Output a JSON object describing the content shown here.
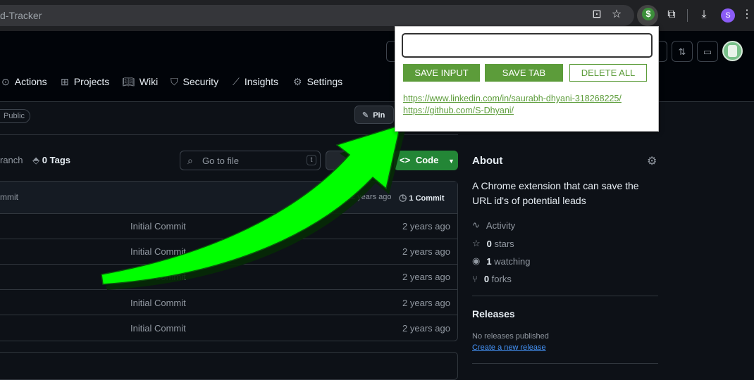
{
  "browser": {
    "url_fragment": "d-Tracker",
    "profile_initial": "S",
    "extension_symbol": "$"
  },
  "repo_nav": {
    "items": [
      {
        "label": "Actions",
        "icon": "play-circle-icon"
      },
      {
        "label": "Projects",
        "icon": "table-icon"
      },
      {
        "label": "Wiki",
        "icon": "book-icon"
      },
      {
        "label": "Security",
        "icon": "shield-icon"
      },
      {
        "label": "Insights",
        "icon": "graph-icon"
      },
      {
        "label": "Settings",
        "icon": "gear-icon"
      }
    ]
  },
  "repo": {
    "visibility": "Public",
    "pin_label": "Pin",
    "branch_label": "ranch",
    "tags_count": "0",
    "tags_label": "Tags",
    "go_to_file_placeholder": "Go to file",
    "go_to_file_shortcut": "t",
    "code_button": "Code"
  },
  "files": {
    "head_commit": "mmit",
    "head_time": "2 years ago",
    "commit_count": "1 Commit",
    "rows": [
      {
        "message": "Initial Commit",
        "time": "2 years ago"
      },
      {
        "message": "Initial Commit",
        "time": "2 years ago"
      },
      {
        "message": "Initial Commit",
        "time": "2 years ago"
      },
      {
        "message": "Initial Commit",
        "time": "2 years ago"
      },
      {
        "message": "Initial Commit",
        "time": "2 years ago"
      }
    ]
  },
  "about": {
    "title": "About",
    "description": "A Chrome extension that can save the URL id's of potential leads",
    "activity": "Activity",
    "stars_count": "0",
    "stars_label": "stars",
    "watching_count": "1",
    "watching_label": "watching",
    "forks_count": "0",
    "forks_label": "forks"
  },
  "releases": {
    "title": "Releases",
    "empty_text": "No releases published",
    "create_link": "Create a new release"
  },
  "popup": {
    "input_value": "",
    "save_input": "SAVE INPUT",
    "save_tab": "SAVE TAB",
    "delete_all": "DELETE ALL",
    "links": [
      "https://www.linkedin.com/in/saurabh-dhyani-318268225/",
      "https://github.com/S-Dhyani/"
    ],
    "accent_color": "#5c9c3a"
  },
  "annotation": {
    "arrow_color": "#00ff00"
  }
}
